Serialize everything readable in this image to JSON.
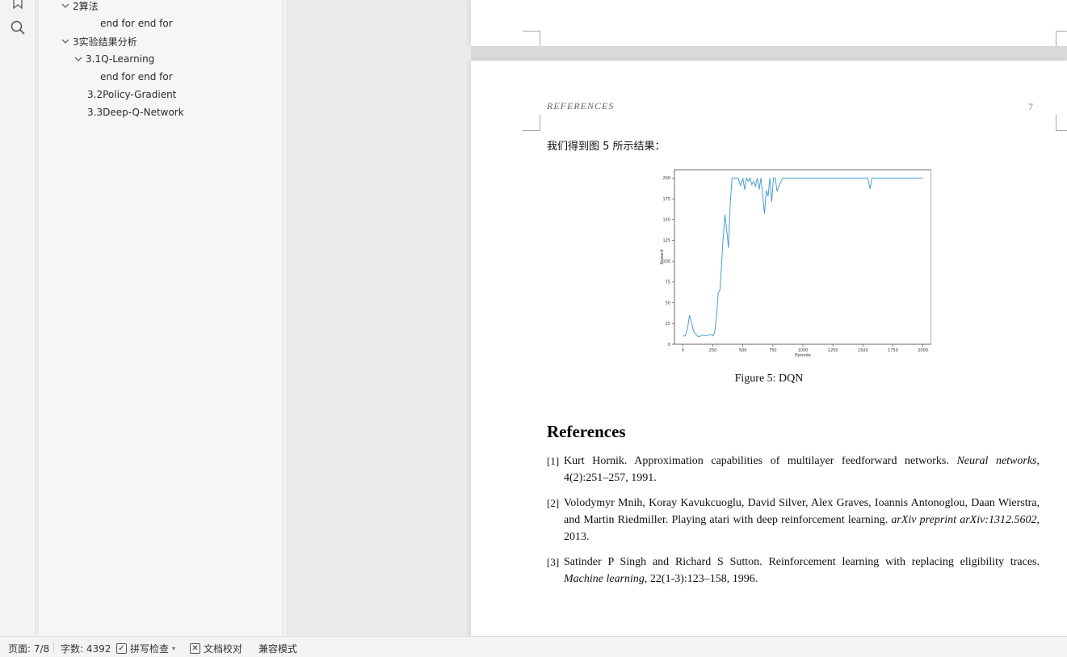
{
  "outline": {
    "items": [
      {
        "label": "2算法",
        "expanded": true
      },
      {
        "label": "end for end for"
      },
      {
        "label": "3实验结果分析",
        "expanded": true
      },
      {
        "label": "3.1Q-Learning",
        "expanded": true
      },
      {
        "label": "end for end for"
      },
      {
        "label": "3.2Policy-Gradient"
      },
      {
        "label": "3.3Deep-Q-Network"
      }
    ]
  },
  "rail": {
    "icons": [
      "bookmark-icon",
      "search-icon"
    ]
  },
  "document": {
    "running_header": "REFERENCES",
    "page_number": "7",
    "intro_text": "我们得到图 5 所示结果：",
    "figure_caption": "Figure 5: DQN",
    "references_title": "References",
    "references": [
      {
        "num": "[1]",
        "text": "Kurt Hornik. Approximation capabilities of multilayer feedforward networks. ",
        "venue": "Neural networks",
        "tail": ", 4(2):251–257, 1991."
      },
      {
        "num": "[2]",
        "text": "Volodymyr Mnih, Koray Kavukcuoglu, David Silver, Alex Graves, Ioannis Antonoglou, Daan Wierstra, and Martin Riedmiller. Playing atari with deep reinforcement learning. ",
        "venue": "arXiv preprint arXiv:1312.5602",
        "tail": ", 2013."
      },
      {
        "num": "[3]",
        "text": "Satinder P Singh and Richard S Sutton. Reinforcement learning with replacing eligibility traces. ",
        "venue": "Machine learning",
        "tail": ", 22(1-3):123–158, 1996."
      }
    ]
  },
  "chart_data": {
    "type": "line",
    "title": "",
    "xlabel": "Episode",
    "ylabel": "Reward",
    "xlim": [
      -70,
      2070
    ],
    "ylim": [
      0,
      210
    ],
    "xticks": [
      0,
      250,
      500,
      750,
      1000,
      1250,
      1500,
      1750,
      2000
    ],
    "yticks": [
      0,
      25,
      50,
      75,
      100,
      125,
      150,
      175,
      200
    ],
    "color": "#4a9fd0",
    "series": [
      {
        "x": [
          0,
          20,
          40,
          55,
          70,
          90,
          110,
          130,
          150,
          170,
          190,
          210,
          230,
          250,
          265,
          280,
          295,
          310,
          330,
          350,
          365,
          380,
          395,
          410,
          425,
          440,
          460,
          480,
          500,
          515,
          530,
          545,
          560,
          575,
          590,
          605,
          620,
          635,
          650,
          665,
          680,
          695,
          710,
          725,
          740,
          755,
          770,
          785,
          800,
          815,
          830,
          860,
          900,
          950,
          1000,
          1100,
          1200,
          1300,
          1400,
          1500,
          1540,
          1560,
          1575,
          1600,
          1700,
          1800,
          1900,
          2000
        ],
        "y": [
          10,
          10,
          20,
          35,
          28,
          15,
          12,
          9,
          10,
          11,
          10,
          11,
          12,
          10,
          14,
          33,
          62,
          66,
          115,
          156,
          138,
          116,
          170,
          200,
          200,
          200,
          200,
          191,
          200,
          186,
          200,
          196,
          200,
          192,
          196,
          190,
          200,
          186,
          200,
          180,
          157,
          185,
          178,
          200,
          171,
          200,
          200,
          184,
          190,
          195,
          200,
          200,
          200,
          200,
          200,
          200,
          200,
          200,
          200,
          200,
          200,
          187,
          200,
          200,
          200,
          200,
          200,
          200
        ]
      }
    ]
  },
  "status": {
    "page": "页面: 7/8",
    "words": "字数: 4392",
    "spell": "拼写检查",
    "proof": "文档校对",
    "compat": "兼容模式"
  }
}
